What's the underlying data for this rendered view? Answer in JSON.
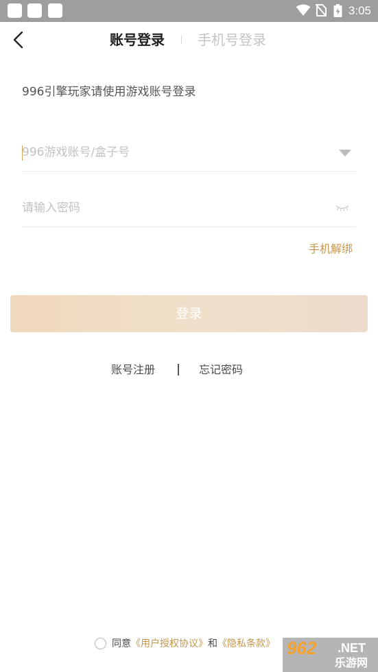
{
  "status_bar": {
    "time": "3:05",
    "icons": [
      "wifi-icon",
      "no-sim-icon",
      "battery-charging-icon"
    ],
    "background": "#9e9e9e"
  },
  "header": {
    "back_icon": "chevron-left-icon",
    "tab_account": "账号登录",
    "tab_phone": "手机号登录"
  },
  "form": {
    "hint": "996引擎玩家请使用游戏账号登录",
    "account_placeholder": "996游戏账号/盒子号",
    "account_value": "",
    "password_placeholder": "请输入密码",
    "password_value": "",
    "dropdown_icon": "triangle-down-icon",
    "eye_icon": "eye-closed-icon",
    "unbind_link": "手机解绑",
    "login_button": "登录"
  },
  "links": {
    "register": "账号注册",
    "separator": "|",
    "forgot": "忘记密码"
  },
  "agreement": {
    "prefix": "同意",
    "user_agreement": "《用户授权协议》",
    "and": "和",
    "privacy": "《隐私条款》",
    "checked": false
  },
  "watermark": {
    "number": "962",
    "net": ".NET",
    "cn": "乐游网"
  },
  "colors": {
    "accent": "#c5964e",
    "button_gradient_start": "#efd9bd",
    "button_gradient_end": "#ebdccb",
    "placeholder": "#c2c2c2",
    "inactive_tab": "#c4c4c4"
  }
}
